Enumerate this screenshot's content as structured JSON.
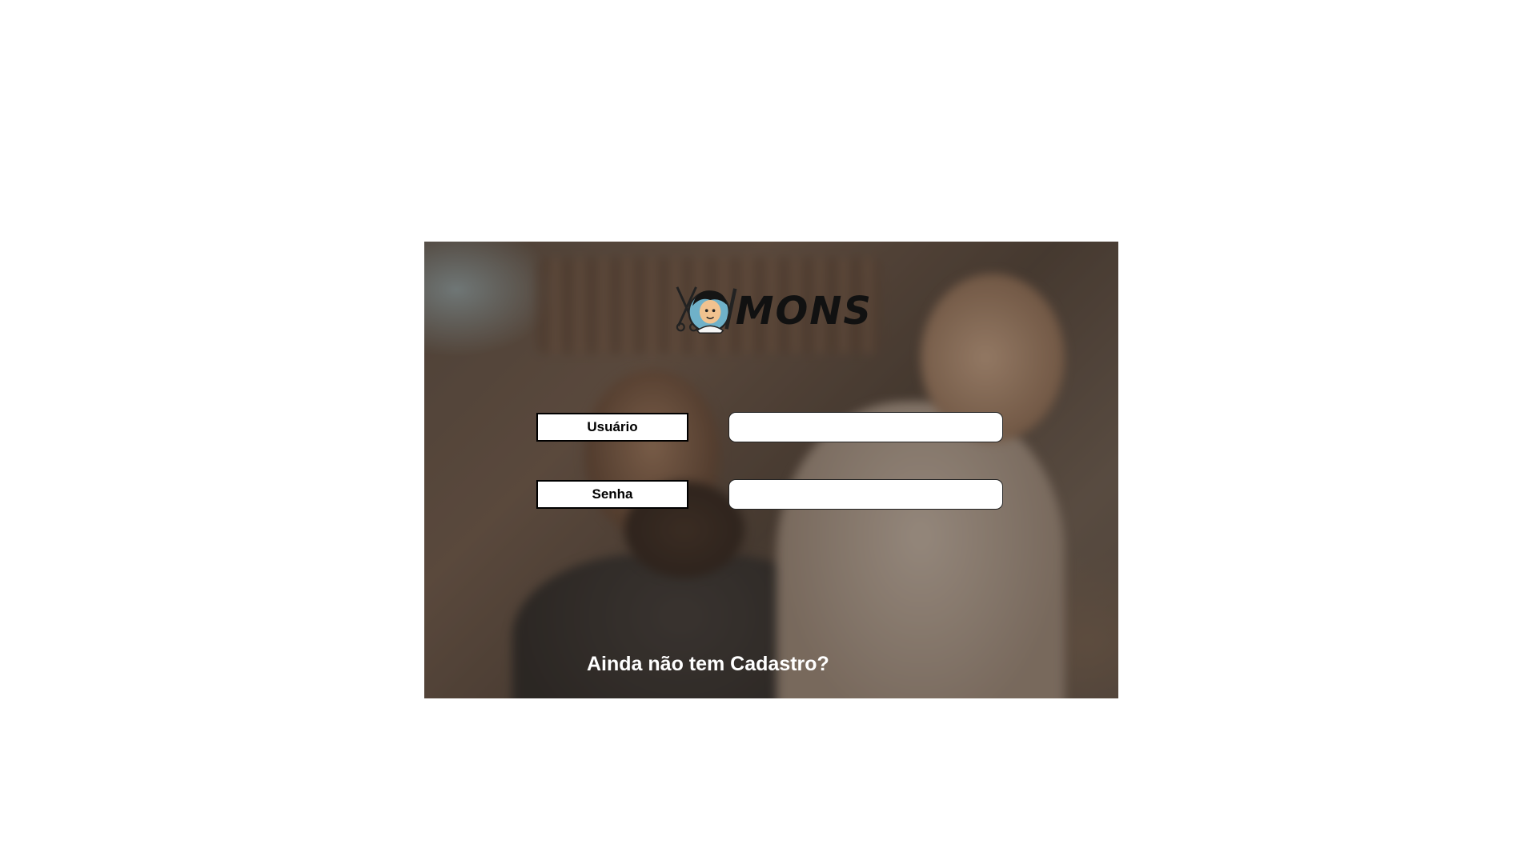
{
  "brand": {
    "logo_text": "MONS",
    "logo_icon": "barber-mascot-icon"
  },
  "form": {
    "username_label": "Usuário",
    "username_value": "",
    "username_placeholder": "",
    "password_label": "Senha",
    "password_value": "",
    "password_placeholder": ""
  },
  "signup": {
    "link_text": "Ainda não tem Cadastro?"
  },
  "colors": {
    "page_background": "#ffffff",
    "label_background": "#ffffff",
    "label_border": "#000000",
    "link_text": "#ffffff"
  }
}
